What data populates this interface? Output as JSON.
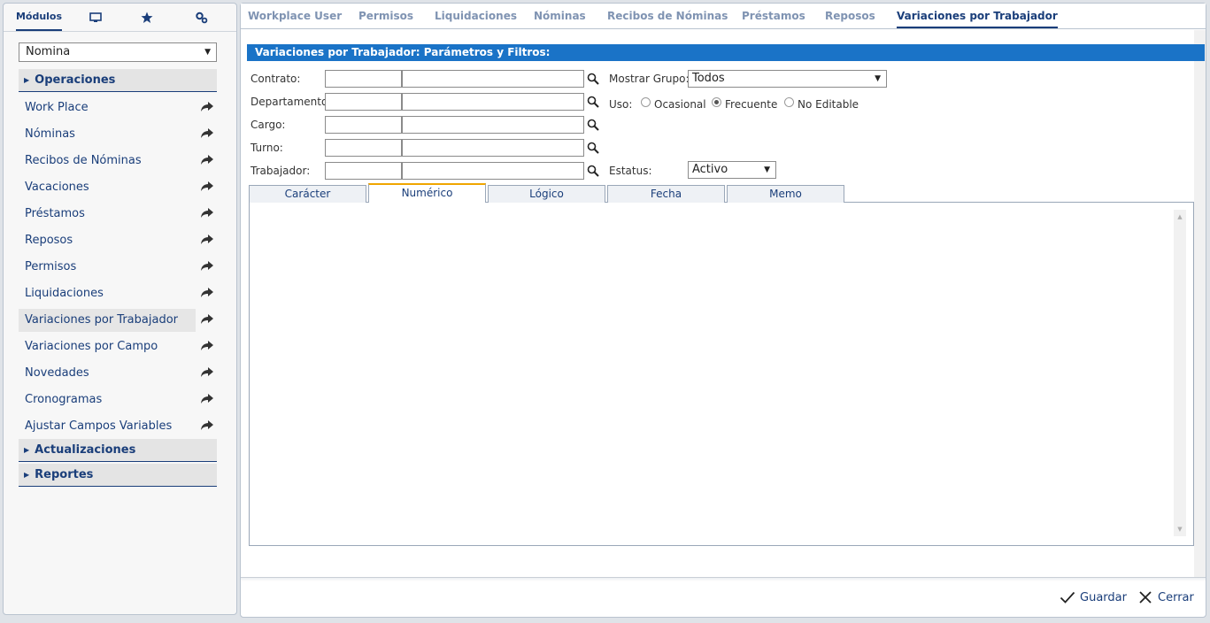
{
  "left_tabs": {
    "modules_label": "Módulos",
    "icons": [
      "monitor-icon",
      "star-icon",
      "settings-icon"
    ]
  },
  "module_select": {
    "value": "Nomina"
  },
  "sections": {
    "operaciones": "Operaciones",
    "actualizaciones": "Actualizaciones",
    "reportes": "Reportes"
  },
  "nav_items": [
    "Work Place",
    "Nóminas",
    "Recibos de Nóminas",
    "Vacaciones",
    "Préstamos",
    "Reposos",
    "Permisos",
    "Liquidaciones",
    "Variaciones por Trabajador",
    "Variaciones por Campo",
    "Novedades",
    "Cronogramas",
    "Ajustar Campos Variables"
  ],
  "selected_nav": "Variaciones por Trabajador",
  "top_tabs": [
    "Workplace User",
    "Permisos",
    "Liquidaciones",
    "Nóminas",
    "Recibos de Nóminas",
    "Préstamos",
    "Reposos",
    "Variaciones por Trabajador"
  ],
  "active_top_tab": "Variaciones por Trabajador",
  "panel_title": "Variaciones por Trabajador: Parámetros y Filtros:",
  "filters": {
    "contrato": "Contrato:",
    "departamento": "Departamento:",
    "cargo": "Cargo:",
    "turno": "Turno:",
    "trabajador": "Trabajador:",
    "mostrar_grupo_label": "Mostrar Grupo:",
    "mostrar_grupo_value": "Todos",
    "uso_label": "Uso:",
    "uso_options": [
      "Ocasional",
      "Frecuente",
      "No Editable"
    ],
    "uso_selected": "Frecuente",
    "estatus_label": "Estatus:",
    "estatus_value": "Activo"
  },
  "type_tabs": [
    "Carácter",
    "Numérico",
    "Lógico",
    "Fecha",
    "Memo"
  ],
  "active_type_tab": "Numérico",
  "footer": {
    "save_label": "Guardar",
    "close_label": "Cerrar"
  },
  "colors": {
    "accent": "#1a3e7a",
    "header_bar": "#1a73c7",
    "tab_highlight": "#f0a500"
  }
}
